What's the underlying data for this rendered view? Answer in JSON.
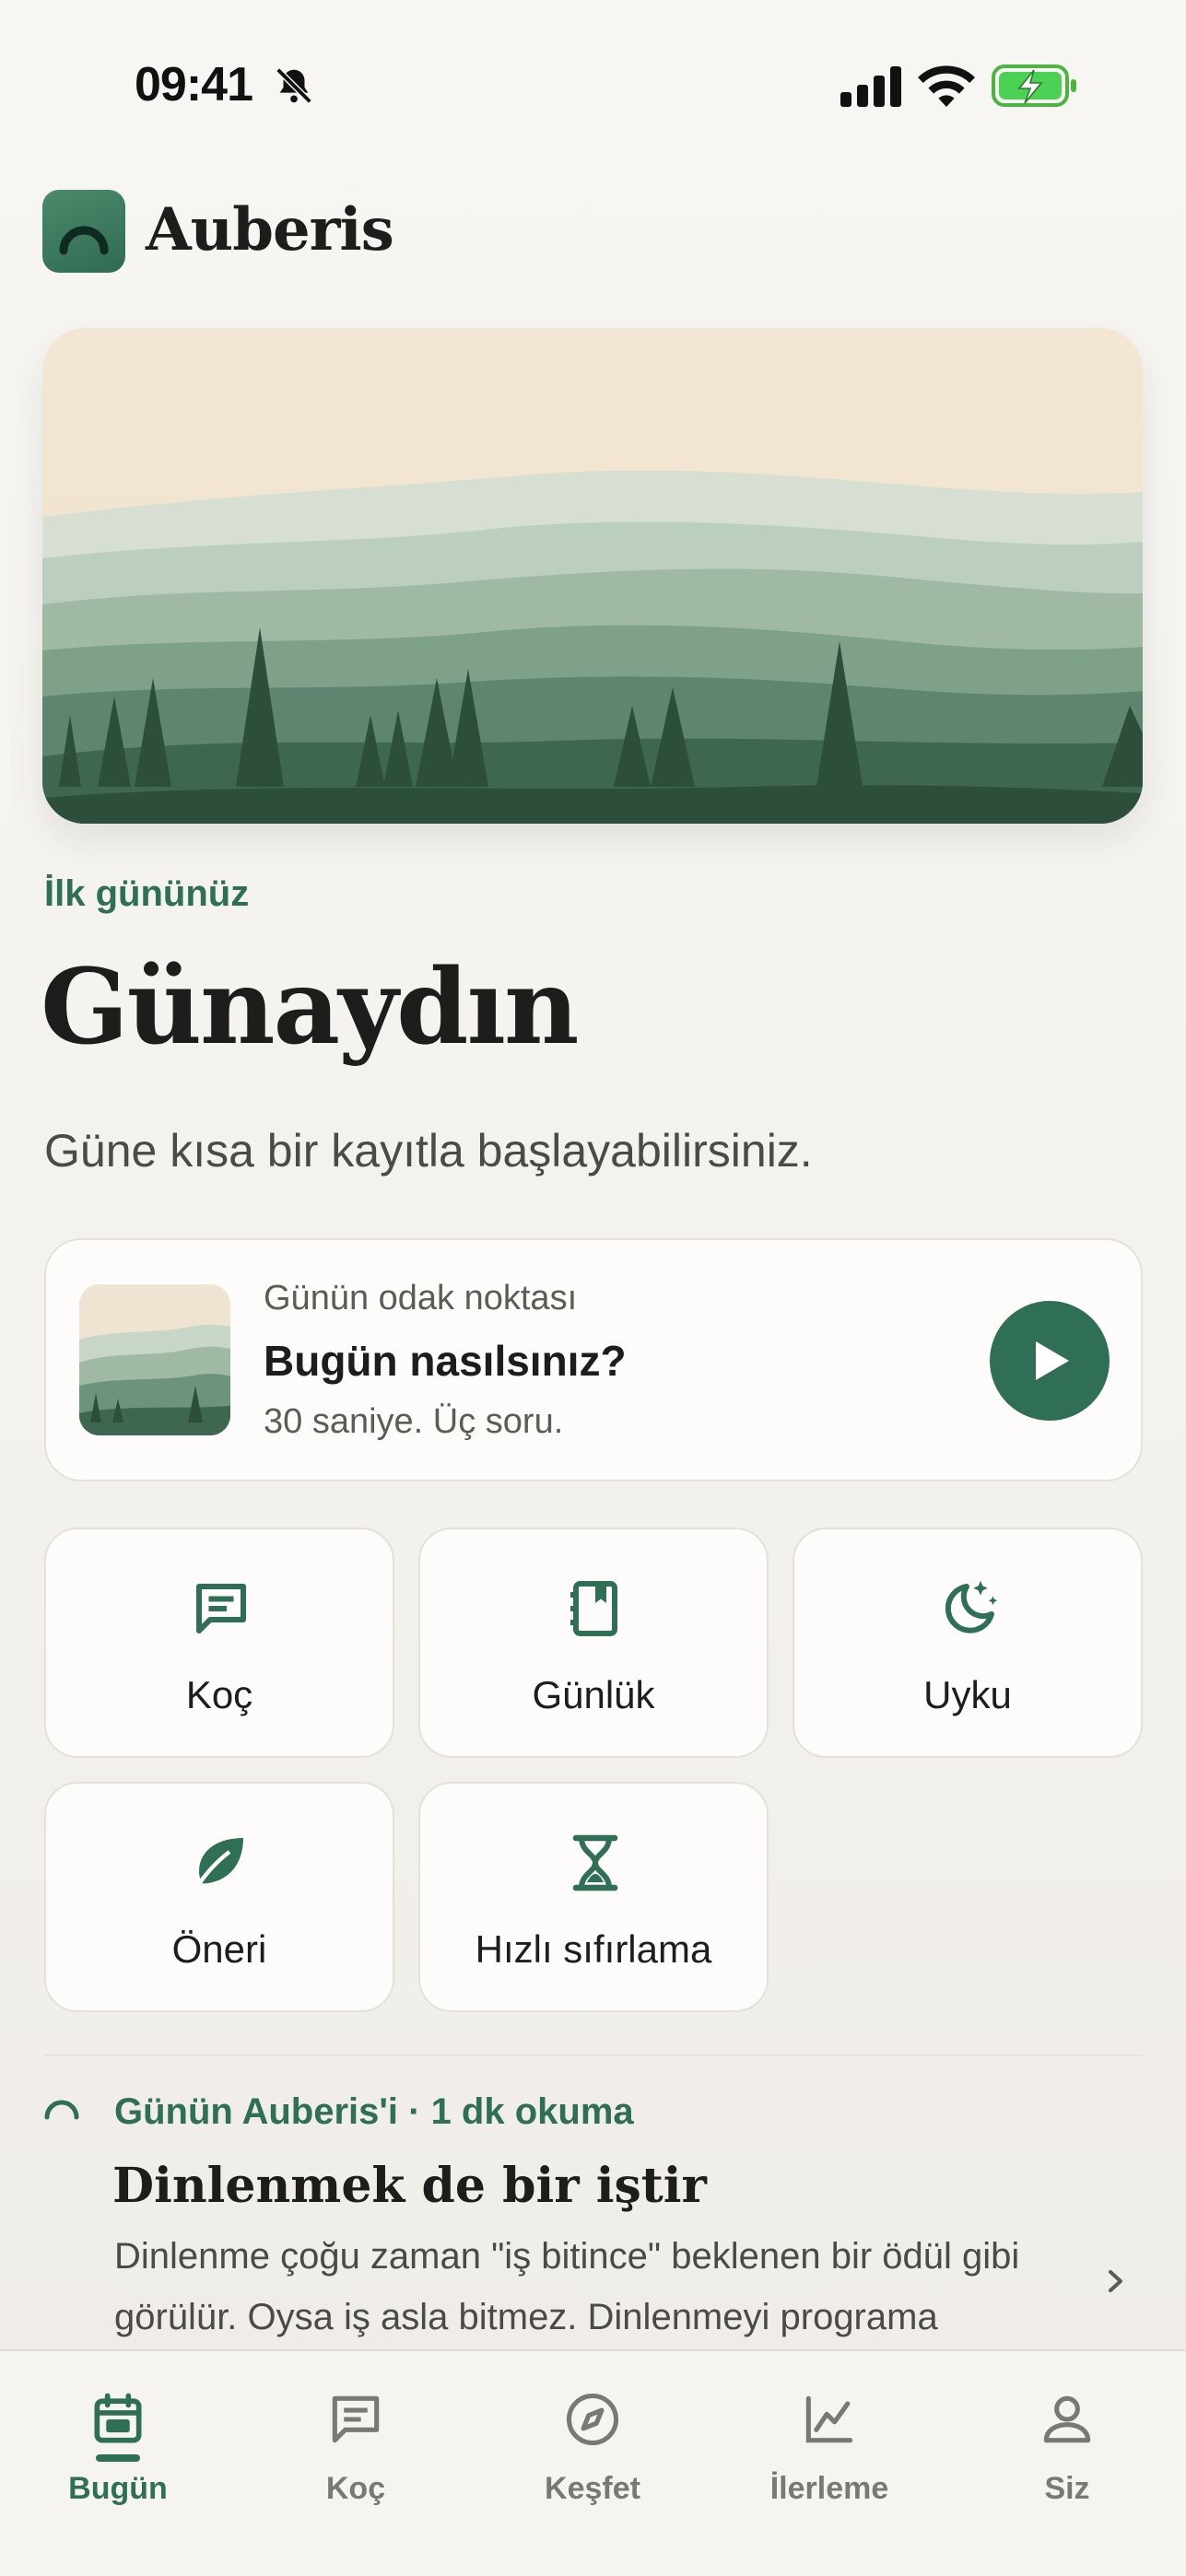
{
  "status": {
    "time": "09:41",
    "icons": [
      "bell-slash-icon",
      "cellular-signal-icon",
      "wifi-icon",
      "battery-charging-icon"
    ]
  },
  "header": {
    "app_name": "Auberis",
    "logo_icon": "arc-logo-icon"
  },
  "hero": {
    "image": "misty-forest-landscape"
  },
  "greeting": {
    "eyebrow": "İlk gününüz",
    "title": "Günaydın",
    "subtitle": "Güne kısa bir kayıtla başlayabilirsiniz."
  },
  "focus": {
    "kicker": "Günün odak noktası",
    "title": "Bugün nasılsınız?",
    "meta": "30 saniye. Üç soru.",
    "action_icon": "play-icon"
  },
  "tiles": [
    {
      "label": "Koç",
      "icon": "chat-icon"
    },
    {
      "label": "Günlük",
      "icon": "journal-icon"
    },
    {
      "label": "Uyku",
      "icon": "moon-stars-icon"
    },
    {
      "label": "Öneri",
      "icon": "leaf-icon"
    },
    {
      "label": "Hızlı sıfırlama",
      "icon": "hourglass-icon"
    }
  ],
  "article": {
    "meta": "Günün Auberis'i · 1 dk okuma",
    "title": "Dinlenmek de bir iştir",
    "body": "Dinlenme çoğu zaman \"iş bitince\" beklenen bir ödül gibi görülür. Oysa iş asla bitmez. Dinlenmeyi programa"
  },
  "tabs": [
    {
      "label": "Bugün",
      "icon": "calendar-icon",
      "active": true
    },
    {
      "label": "Koç",
      "icon": "chat-icon",
      "active": false
    },
    {
      "label": "Keşfet",
      "icon": "compass-icon",
      "active": false
    },
    {
      "label": "İlerleme",
      "icon": "chart-line-icon",
      "active": false
    },
    {
      "label": "Siz",
      "icon": "person-icon",
      "active": false
    }
  ],
  "colors": {
    "accent": "#2e6f55",
    "background": "#f4f2ee",
    "card": "#fdfcfa",
    "text": "#1d1d1b",
    "muted": "#7a7872"
  }
}
